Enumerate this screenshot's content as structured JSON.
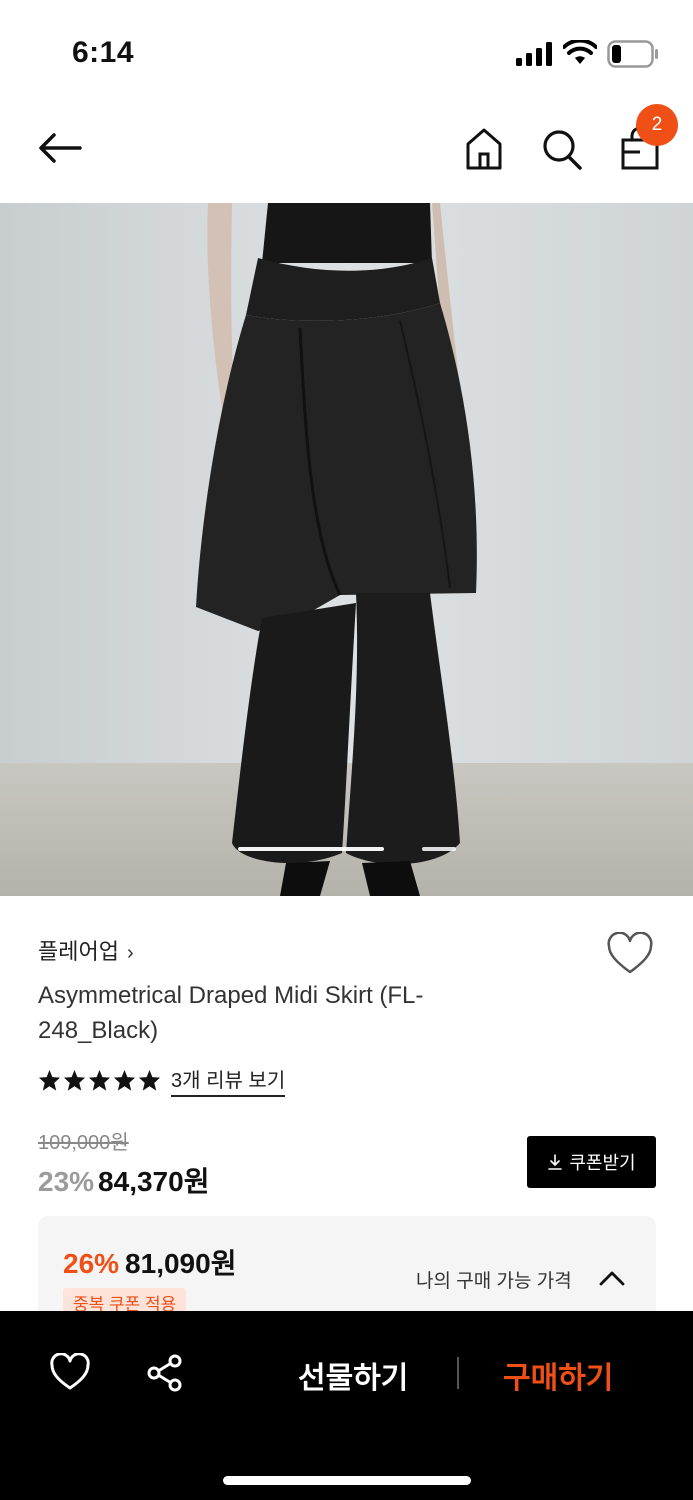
{
  "status_bar": {
    "time": "6:14"
  },
  "header": {
    "cart_count": "2"
  },
  "product": {
    "brand": "플레어업",
    "title": "Asymmetrical Draped Midi Skirt (FL-248_Black)",
    "rating_stars": 5,
    "review_link": "3개 리뷰 보기",
    "original_price": "109,000원",
    "discount_rate": "23%",
    "sale_price": "84,370원",
    "coupon_button": "쿠폰받기"
  },
  "best_price": {
    "rate": "26%",
    "price": "81,090원",
    "label": "나의 구매 가능 가격",
    "tag": "중복 쿠폰 적용"
  },
  "bottom_bar": {
    "gift_label": "선물하기",
    "buy_label": "구매하기"
  },
  "colors": {
    "accent": "#f04f16",
    "bar": "#000000"
  }
}
